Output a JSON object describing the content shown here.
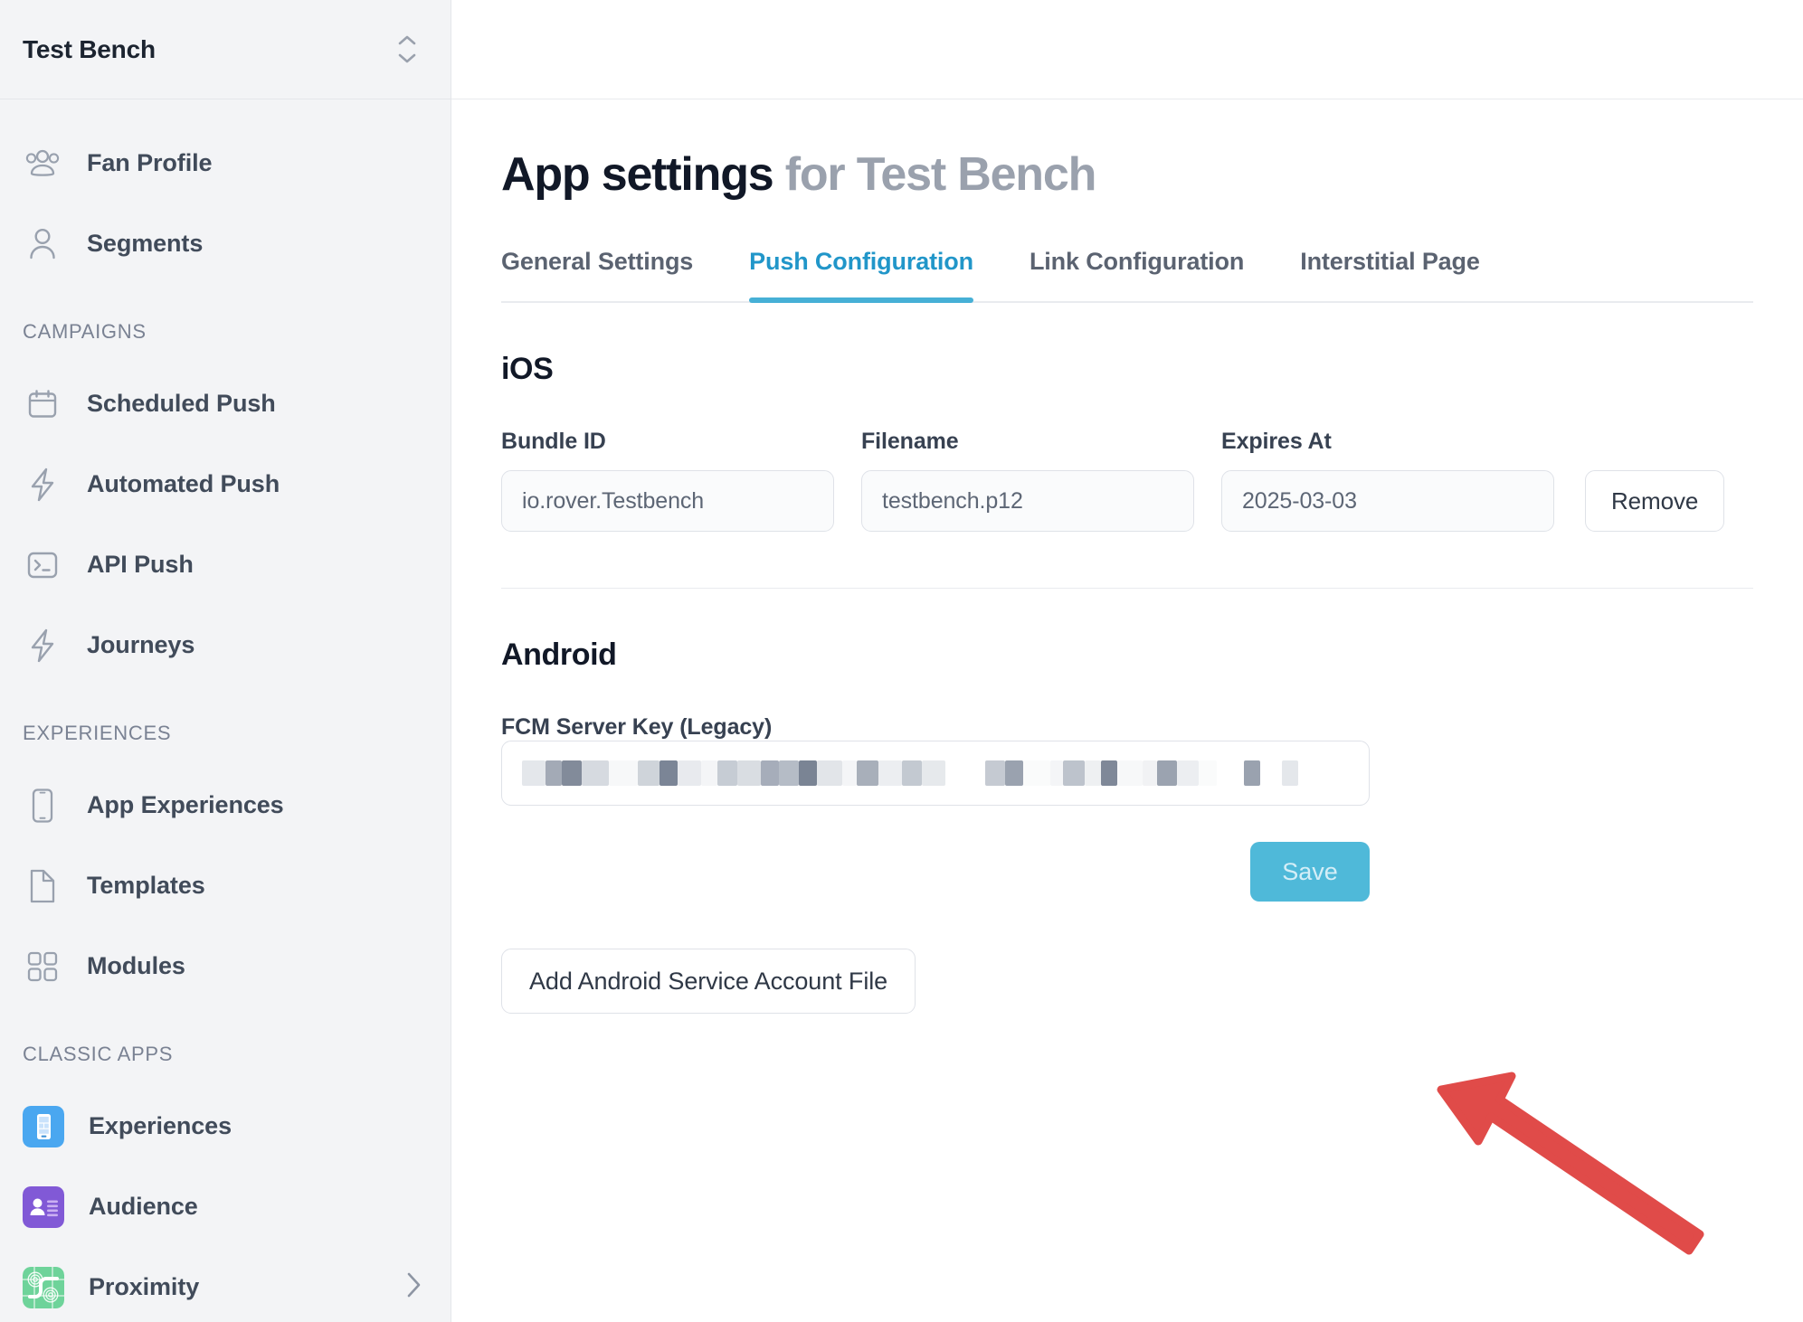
{
  "sidebar": {
    "header": {
      "title": "Test Bench",
      "switcher_icon": "up-down-chevron-icon"
    },
    "groups": [
      {
        "title": null,
        "items": [
          {
            "label": "Fan Profile",
            "icon": "people-group-icon"
          },
          {
            "label": "Segments",
            "icon": "person-icon"
          }
        ]
      },
      {
        "title": "CAMPAIGNS",
        "items": [
          {
            "label": "Scheduled Push",
            "icon": "calendar-icon"
          },
          {
            "label": "Automated Push",
            "icon": "lightning-bolt-icon"
          },
          {
            "label": "API Push",
            "icon": "terminal-icon"
          },
          {
            "label": "Journeys",
            "icon": "lightning-bolt-icon"
          }
        ]
      },
      {
        "title": "EXPERIENCES",
        "items": [
          {
            "label": "App Experiences",
            "icon": "mobile-phone-icon"
          },
          {
            "label": "Templates",
            "icon": "document-icon"
          },
          {
            "label": "Modules",
            "icon": "grid-squares-icon"
          }
        ]
      },
      {
        "title": "CLASSIC APPS",
        "items": [
          {
            "label": "Experiences",
            "icon": "classic-experiences-app-icon",
            "color": "#4aa7f0"
          },
          {
            "label": "Audience",
            "icon": "classic-audience-app-icon",
            "color": "#8159d6"
          },
          {
            "label": "Proximity",
            "icon": "classic-proximity-app-icon",
            "color": "#6ed39a",
            "chevron": "chevron-right-icon"
          }
        ]
      }
    ]
  },
  "main": {
    "page_title": {
      "bold": "App settings",
      "muted": "for Test Bench"
    },
    "tabs": [
      {
        "label": "General Settings",
        "active": false
      },
      {
        "label": "Push Configuration",
        "active": true
      },
      {
        "label": "Link Configuration",
        "active": false
      },
      {
        "label": "Interstitial Page",
        "active": false
      }
    ],
    "ios": {
      "heading": "iOS",
      "fields": [
        {
          "label": "Bundle ID",
          "value": "io.rover.Testbench"
        },
        {
          "label": "Filename",
          "value": "testbench.p12"
        },
        {
          "label": "Expires At",
          "value": "2025-03-03"
        }
      ],
      "remove_label": "Remove"
    },
    "android": {
      "heading": "Android",
      "fcm_label": "FCM Server Key (Legacy)",
      "fcm_value_redacted": true,
      "save_label": "Save",
      "add_file_label": "Add Android Service Account File"
    },
    "annotation": {
      "type": "arrow",
      "color": "#e04b49",
      "points_to": "Add Android Service Account File"
    }
  },
  "colors": {
    "accent": "#46b0d6",
    "active_tab_text": "#2196c9",
    "save_button": "#4fb9d9",
    "arrow": "#e04b49",
    "sidebar_bg": "#f3f4f6"
  }
}
